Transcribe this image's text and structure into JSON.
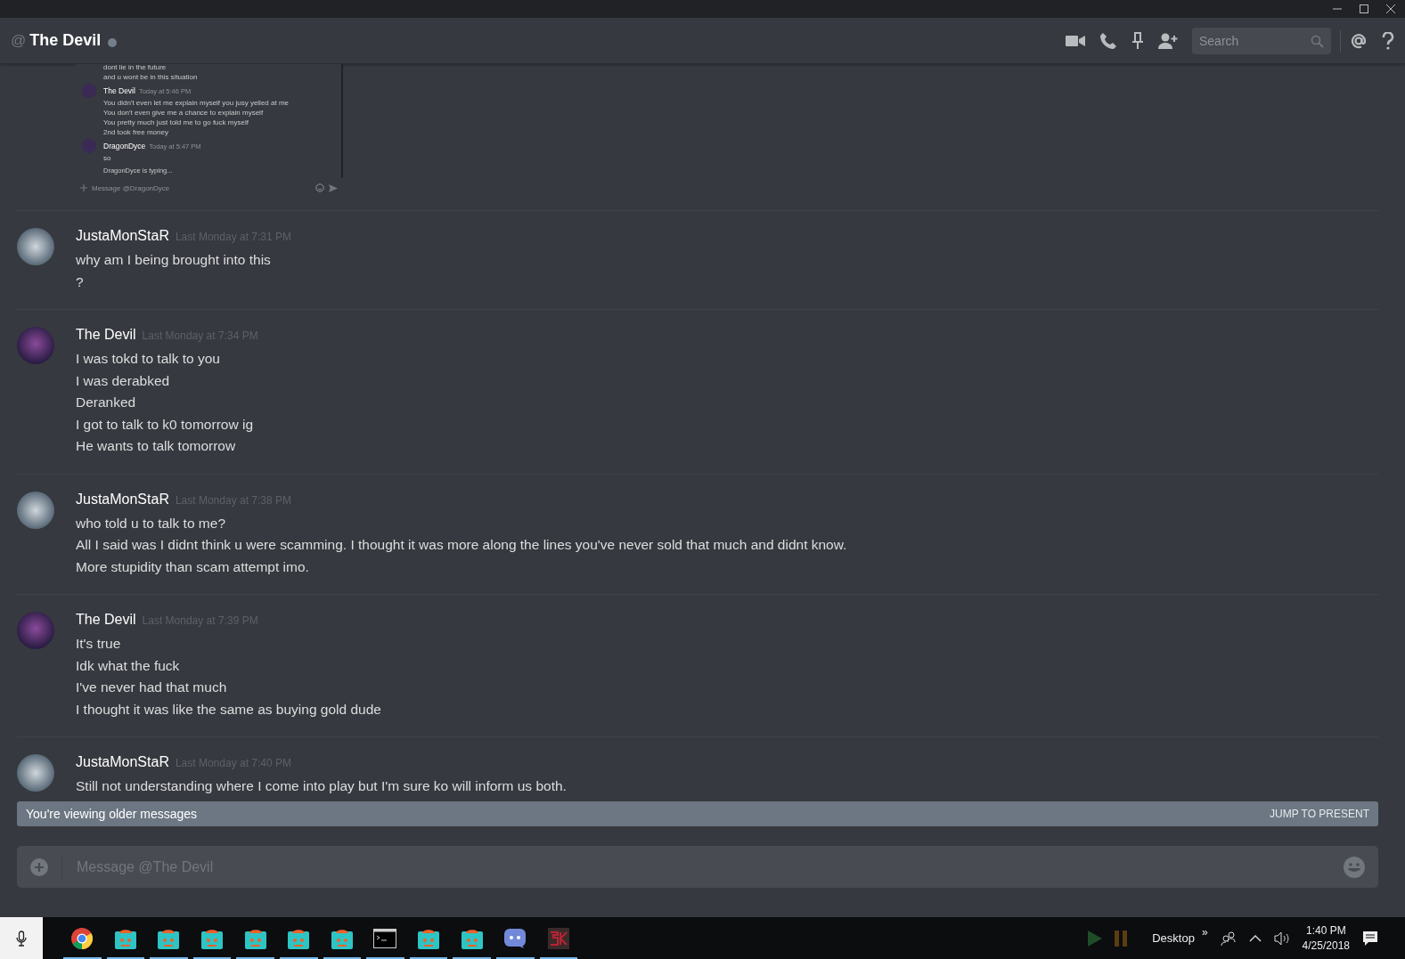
{
  "header": {
    "at": "@",
    "title": "The Devil",
    "online": false,
    "search": {
      "placeholder": "Search"
    }
  },
  "attachment": {
    "lines": [
      {
        "kind": "text",
        "text": "dont lie in the future"
      },
      {
        "kind": "text",
        "text": "and u wont be in this situation"
      },
      {
        "kind": "author",
        "text": "The Devil",
        "time": "Today at 5:46 PM"
      },
      {
        "kind": "text",
        "text": "You didn't even let me explain myself you jusy yelled at me"
      },
      {
        "kind": "text",
        "text": "You don't even give me a chance to explain myself"
      },
      {
        "kind": "text",
        "text": "You pretty much just told me to go fuck myself"
      },
      {
        "kind": "text",
        "text": "2nd took free money"
      },
      {
        "kind": "author",
        "text": "DragonDyce",
        "time": "Today at 5:47 PM"
      },
      {
        "kind": "text",
        "text": "so"
      },
      {
        "kind": "typing",
        "text": "DragonDyce is typing..."
      }
    ],
    "composer": "Message @DragonDyce"
  },
  "messages": [
    {
      "author": "JustaMonStaR",
      "time": "Last Monday at 7:31 PM",
      "kind": "monstar",
      "lines": [
        "why am I being brought into this",
        "?"
      ]
    },
    {
      "author": "The Devil",
      "time": "Last Monday at 7:34 PM",
      "kind": "devil",
      "lines": [
        "I was tokd to talk to you",
        "I was derabked",
        "Deranked",
        "I got to talk to k0 tomorrow ig",
        "He wants to talk tomorrow"
      ]
    },
    {
      "author": "JustaMonStaR",
      "time": "Last Monday at 7:38 PM",
      "kind": "monstar",
      "lines": [
        "who told u to talk to me?",
        "All I said was I didnt think u were scamming. I thought it was more along the lines you've never sold that much and didnt know.",
        "More stupidity than scam attempt imo."
      ]
    },
    {
      "author": "The Devil",
      "time": "Last Monday at 7:39 PM",
      "kind": "devil",
      "lines": [
        "It's true",
        "Idk what the fuck",
        "I've never had that much",
        "I thought it was like the same as buying gold dude"
      ]
    },
    {
      "author": "JustaMonStaR",
      "time": "Last Monday at 7:40 PM",
      "kind": "monstar",
      "lines": [
        "Still not understanding where I come into play but I'm sure ko will inform us both."
      ]
    }
  ],
  "banner": {
    "text": "You're viewing older messages",
    "action": "JUMP TO PRESENT"
  },
  "composer": {
    "placeholder": "Message @The Devil"
  },
  "taskbar": {
    "overflow": "»",
    "desktop": "Desktop",
    "time": "1:40 PM",
    "date": "4/25/2018"
  }
}
